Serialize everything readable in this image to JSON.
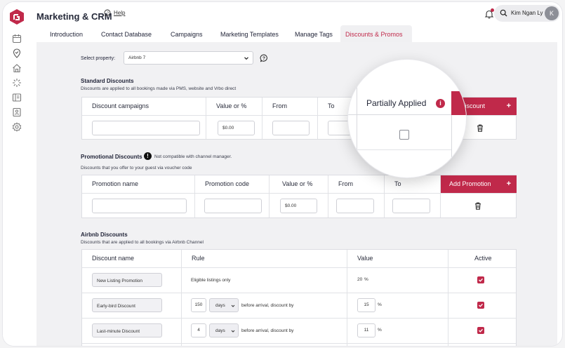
{
  "app": {
    "title": "Marketing & CRM",
    "help": "Help"
  },
  "user": {
    "name": "Kim Ngan Ly",
    "initial": "K"
  },
  "tabs": [
    "Introduction",
    "Contact Database",
    "Campaigns",
    "Marketing Templates",
    "Manage Tags",
    "Discounts & Promos"
  ],
  "active_tab": "Discounts & Promos",
  "property": {
    "label": "Select property:",
    "value": "Airbnb 7"
  },
  "standard": {
    "title": "Standard Discounts",
    "subtitle": "Discounts are applied to all bookings made via PMS, website and Vrbo direct",
    "headers": [
      "Discount campaigns",
      "Value or %",
      "From",
      "To"
    ],
    "add_label": "Discount",
    "add_plus": "+",
    "value_placeholder": "$0.00"
  },
  "magnifier": {
    "label": "Partially Applied",
    "info": "i"
  },
  "promo": {
    "title": "Promotional Discounts",
    "note": "Not compatible with channel manager.",
    "subtitle": "Discounts that you offer to your guest via voucher code",
    "headers": [
      "Promotion name",
      "Promotion code",
      "Value or %",
      "From",
      "To"
    ],
    "add_label": "Add Promotion",
    "add_plus": "+",
    "value_placeholder": "$0.00"
  },
  "airbnb": {
    "title": "Airbnb Discounts",
    "subtitle": "Discounts that are applied to all bookings via Airbnb Channel",
    "headers": [
      "Discount name",
      "Rule",
      "Value",
      "Active"
    ],
    "rows": [
      {
        "name": "New Listing Promotion",
        "rule": "Eligible listings only",
        "value": "20",
        "unit": "%"
      },
      {
        "name": "Early-bird Discount",
        "days": "150",
        "days_unit": "days",
        "rule": "before arrival, discount by",
        "value": "15",
        "unit": "%"
      },
      {
        "name": "Last-minute Discount",
        "days": "4",
        "days_unit": "days",
        "rule": "before arrival, discount by",
        "value": "11",
        "unit": "%"
      }
    ]
  },
  "colors": {
    "accent": "#c0294a",
    "text": "#23263a"
  }
}
